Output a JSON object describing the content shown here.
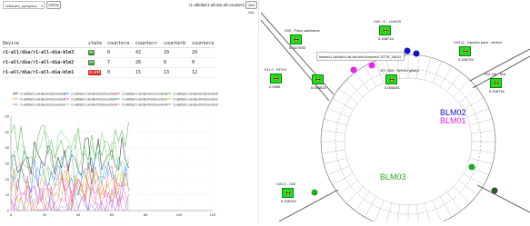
{
  "toolbar": {
    "select_value": "Wildcard_synoptics",
    "open_label": "OPEN",
    "device_path": "r1-all/dia/r1-all-dia-all-counter1:",
    "get_info_label": "Get info"
  },
  "table": {
    "headers": [
      "Device",
      "state",
      "countera",
      "counterc",
      "counterb",
      "countera"
    ],
    "rows": [
      {
        "device": "r1-all/dia/r1-all-dia-blm3",
        "state": "ON",
        "state_color": "#2e8b2e",
        "v1": "0",
        "v2": "42",
        "v3": "29",
        "v4": "20"
      },
      {
        "device": "r1-all/dia/r1-all-dia-blm2",
        "state": "ON",
        "state_color": "#2e8b2e",
        "v1": "7",
        "v2": "26",
        "v3": "8",
        "v4": "0"
      },
      {
        "device": "r1-all/dia/r1-all-dia-blm1",
        "state": "ALARM",
        "state_color": "#dd2222",
        "v1": "0",
        "v2": "15",
        "v3": "13",
        "v4": "12"
      }
    ]
  },
  "chart_data": {
    "type": "line",
    "title": "",
    "xlabel": "",
    "ylabel": "",
    "xlim": [
      0,
      120
    ],
    "ylim": [
      0,
      60
    ],
    "xticks": [
      0,
      20,
      40,
      60,
      80,
      100,
      120
    ],
    "yticks": [
      0,
      10,
      20,
      30,
      40,
      50,
      60
    ],
    "grid": true,
    "legend_position": "top",
    "series": [
      {
        "name": "r1-all/dia/r1-all-dia-blm3/countera",
        "color": "#111111"
      },
      {
        "name": "r1-all/dia/r1-all-dia-blm2/countera",
        "color": "#1e66ff"
      },
      {
        "name": "r1-all/dia/r1-all-dia-blm1/countera",
        "color": "#ff3333"
      },
      {
        "name": "r1-all/dia/r1-all-dia-blm3/counterb",
        "color": "#33aa33"
      },
      {
        "name": "r1-all/dia/r1-all-dia-blm2/counterb",
        "color": "#ff9900"
      },
      {
        "name": "r1-all/dia/r1-all-dia-blm1/counterb",
        "color": "#ee44ee"
      },
      {
        "name": "r1-all/dia/r1-all-dia-blm3/counterc",
        "color": "#22bbbb"
      },
      {
        "name": "r1-all/dia/r1-all-dia-blm2/counterc",
        "color": "#bbbb22"
      },
      {
        "name": "r1-all/dia/r1-all-dia-blm1/counterc",
        "color": "#9966ff"
      },
      {
        "name": "r1-all/dia/r1-all-dia-blm3/counterd",
        "color": "#66cc66"
      },
      {
        "name": "r1-all/dia/r1-all-dia-blm2/counterd",
        "color": "#ff66aa"
      },
      {
        "name": "r1-all/dia/r1-all-dia-blm1/counterd",
        "color": "#888888"
      }
    ],
    "generated_note": ""
  },
  "synoptic": {
    "tooltip": "bmsts/r1-all/dia/r1-all-dia-blm1/counter1 ATTR_VALID",
    "labels": {
      "blm02": "BLM02",
      "blm01": "BLM01",
      "blm03": "BLM03"
    },
    "blms": [
      {
        "title": "G00 - Polso sabbiatore",
        "value": "0.16/7092"
      },
      {
        "title": "G00 - D - LUMOS",
        "value": "0.106714"
      },
      {
        "title": "G00-Q - injection pass - section",
        "value": "0.106734"
      },
      {
        "title": "S11.0 - RF/XX",
        "value": "2.0459"
      },
      {
        "title": "",
        "value": "0.000514"
      },
      {
        "title": "S07-S05 - Service galaxy",
        "value": "0.000251"
      },
      {
        "title": "S01-NA - Test",
        "value": "0.105734"
      },
      {
        "title": "G04 D - D05",
        "value": "0.105764"
      }
    ]
  }
}
